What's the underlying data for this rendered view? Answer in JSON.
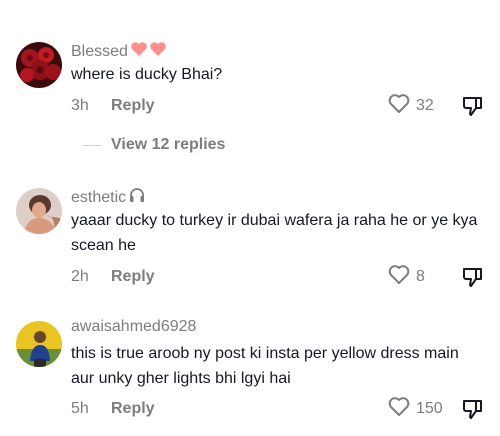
{
  "comments": [
    {
      "username": "Blessed",
      "badge": "two-hearts",
      "text": "where is ducky Bhai?",
      "time": "3h",
      "reply_label": "Reply",
      "likes": "32",
      "avatar": "red-roses"
    },
    {
      "username": "esthetic",
      "badge": "headphones",
      "text": "yaaar ducky to turkey ir dubai wafera ja raha he or ye kya scean he",
      "time": "2h",
      "reply_label": "Reply",
      "likes": "8",
      "avatar": "person-portrait"
    },
    {
      "username": "awaisahmed6928",
      "badge": "",
      "text": "this is true aroob ny post ki insta per yellow dress main aur unky gher lights bhi lgyi hai",
      "time": "5h",
      "reply_label": "Reply",
      "likes": "150",
      "avatar": "person-outdoors"
    }
  ],
  "view_replies": {
    "label": "View 12 replies"
  },
  "colors": {
    "text_primary": "#161823",
    "text_secondary": "#7d7d80",
    "heart_badge": "#ff8f8f"
  }
}
